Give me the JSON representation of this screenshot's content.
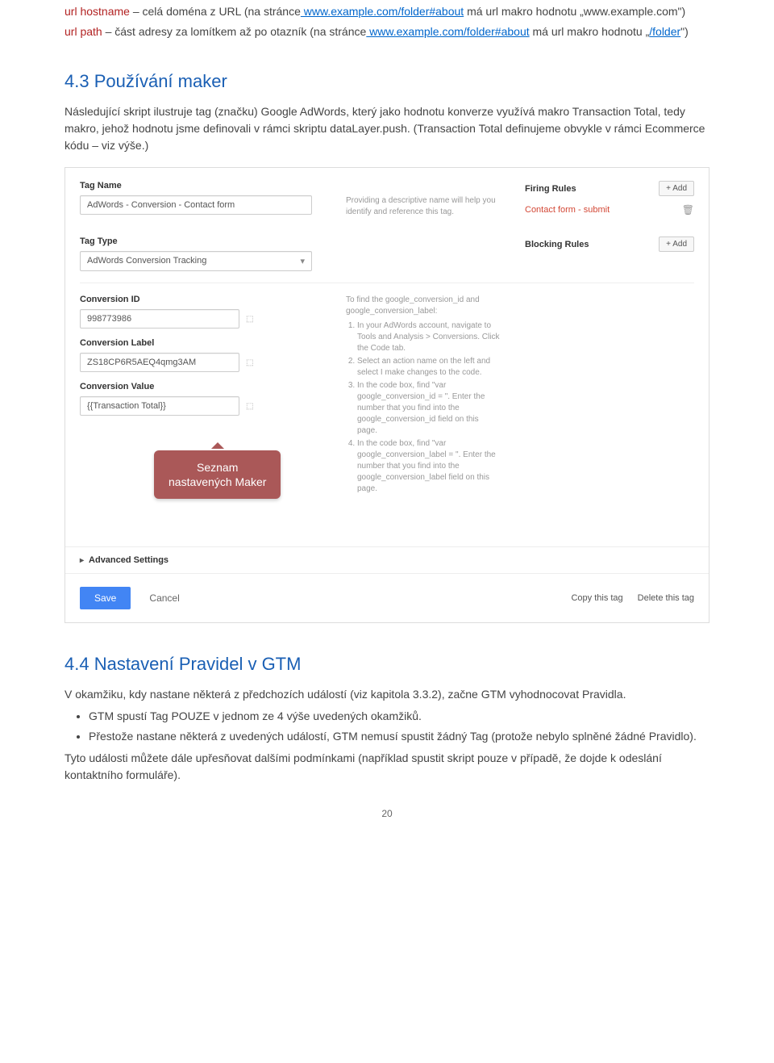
{
  "intro": {
    "hostname_label": "url hostname",
    "hostname_text1": " – celá doména z URL (na stránce",
    "hostname_link1": " www.example.com/folder#about",
    "hostname_text2": " má url makro hodnotu „www.example.com\")",
    "path_label": "url path",
    "path_text1": " – část adresy za lomítkem až po otazník (na stránce",
    "path_link1": " www.example.com/folder#about",
    "path_text2": "má url makro hodnotu „",
    "path_link2": "/folder",
    "path_text3": "\")"
  },
  "section43": {
    "title": "4.3 Používání maker",
    "para": "Následující skript ilustruje tag (značku) Google AdWords, který jako hodnotu konverze využívá makro Transaction Total, tedy makro, jehož hodnotu jsme definovali v rámci skriptu dataLayer.push. (Transaction Total definujeme obvykle v rámci Ecommerce kódu – viz výše.)"
  },
  "screenshot": {
    "tag_name_label": "Tag Name",
    "tag_name_value": "AdWords - Conversion - Contact form",
    "tag_name_help": "Providing a descriptive name will help you identify and reference this tag.",
    "tag_type_label": "Tag Type",
    "tag_type_value": "AdWords Conversion Tracking",
    "firing_rules_label": "Firing Rules",
    "add_btn": "+ Add",
    "firing_rule_item": "Contact form - submit",
    "blocking_rules_label": "Blocking Rules",
    "conv_id_label": "Conversion ID",
    "conv_id_value": "998773986",
    "conv_label_label": "Conversion Label",
    "conv_label_value": "ZS18CP6R5AEQ4qmg3AM",
    "conv_value_label": "Conversion Value",
    "conv_value_value": "{{Transaction Total}}",
    "help_intro": "To find the google_conversion_id and google_conversion_label:",
    "help_steps": [
      "In your AdWords account, navigate to Tools and Analysis > Conversions. Click the Code tab.",
      "Select an action name on the left and select I make changes to the code.",
      "In the code box, find \"var google_conversion_id = \". Enter the number that you find into the google_conversion_id field on this page.",
      "In the code box, find \"var google_conversion_label = \". Enter the number that you find into the google_conversion_label field on this page."
    ],
    "callout_line1": "Seznam",
    "callout_line2": "nastavených Maker",
    "advanced_label": "Advanced Settings",
    "save_btn": "Save",
    "cancel_btn": "Cancel",
    "copy_btn": "Copy this tag",
    "delete_btn": "Delete this tag"
  },
  "section44": {
    "title": "4.4 Nastavení Pravidel v GTM",
    "p1": "V okamžiku, kdy nastane některá z předchozích událostí (viz kapitola 3.3.2), začne GTM vyhodnocovat Pravidla.",
    "b1": "GTM spustí Tag POUZE v jednom ze 4 výše uvedených okamžiků.",
    "b2": "Přestože nastane některá z uvedených událostí, GTM nemusí spustit žádný Tag (protože nebylo splněné žádné Pravidlo).",
    "p2": "Tyto události můžete dále upřesňovat dalšími podmínkami (například spustit skript pouze v případě, že dojde k odeslání kontaktního formuláře).",
    "pagenum": "20"
  }
}
